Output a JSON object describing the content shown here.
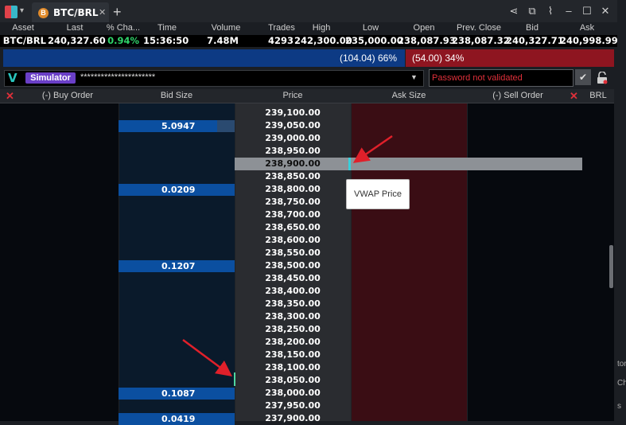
{
  "window": {
    "tab_label": "BTC/BRL",
    "tab_close": "✕",
    "tab_add": "+",
    "controls": [
      "share-icon",
      "export-icon",
      "chart-icon",
      "minimize-icon",
      "maximize-icon",
      "close-icon"
    ],
    "control_glyphs": [
      "⋖",
      "⧉",
      "⌇",
      "–",
      "☐",
      "✕"
    ]
  },
  "quote": {
    "headers": [
      "Asset",
      "Last",
      "% Cha...",
      "Time",
      "Volume",
      "Trades",
      "High",
      "Low",
      "Open",
      "Prev. Close",
      "Bid",
      "Ask"
    ],
    "values": [
      "BTC/BRL",
      "240,327.60",
      "0.94%",
      "15:36:50",
      "7.48M",
      "4293",
      "242,300.00",
      "235,000.00",
      "238,087.93",
      "238,087.32",
      "240,327.71",
      "240,998.99"
    ],
    "change_color": "#2fd36a"
  },
  "pressure": {
    "buy_text": "(104.04) 66%",
    "sell_text": "(54.00) 34%",
    "buy_color": "#0d3a84",
    "sell_color": "#8e1520"
  },
  "account": {
    "logo": "V",
    "badge": "Simulator",
    "masked": "**********************",
    "password_status": "Password not validated",
    "check_glyph": "✔"
  },
  "book": {
    "headers": {
      "buy_order": "(-) Buy Order",
      "bid_size": "Bid Size",
      "price": "Price",
      "ask_size": "Ask Size",
      "sell_order": "(-) Sell Order",
      "currency": "BRL"
    },
    "prices": [
      "239,100.00",
      "239,050.00",
      "239,000.00",
      "238,950.00",
      "238,900.00",
      "238,850.00",
      "238,800.00",
      "238,750.00",
      "238,700.00",
      "238,650.00",
      "238,600.00",
      "238,550.00",
      "238,500.00",
      "238,450.00",
      "238,400.00",
      "238,350.00",
      "238,300.00",
      "238,250.00",
      "238,200.00",
      "238,150.00",
      "238,100.00",
      "238,050.00",
      "238,000.00",
      "237,950.00",
      "237,900.00"
    ],
    "bids": [
      {
        "price": "239,050.00",
        "size": "5.0947"
      },
      {
        "price": "238,800.00",
        "size": "0.0209"
      },
      {
        "price": "238,500.00",
        "size": "0.1207"
      },
      {
        "price": "238,000.00",
        "size": "0.1087"
      },
      {
        "price": "237,900.00",
        "size": "0.0419"
      }
    ],
    "vwap_price": "238,900.00",
    "vwap_tooltip": "VWAP Price"
  },
  "edge_text": [
    "tor",
    "Cha",
    "s"
  ]
}
